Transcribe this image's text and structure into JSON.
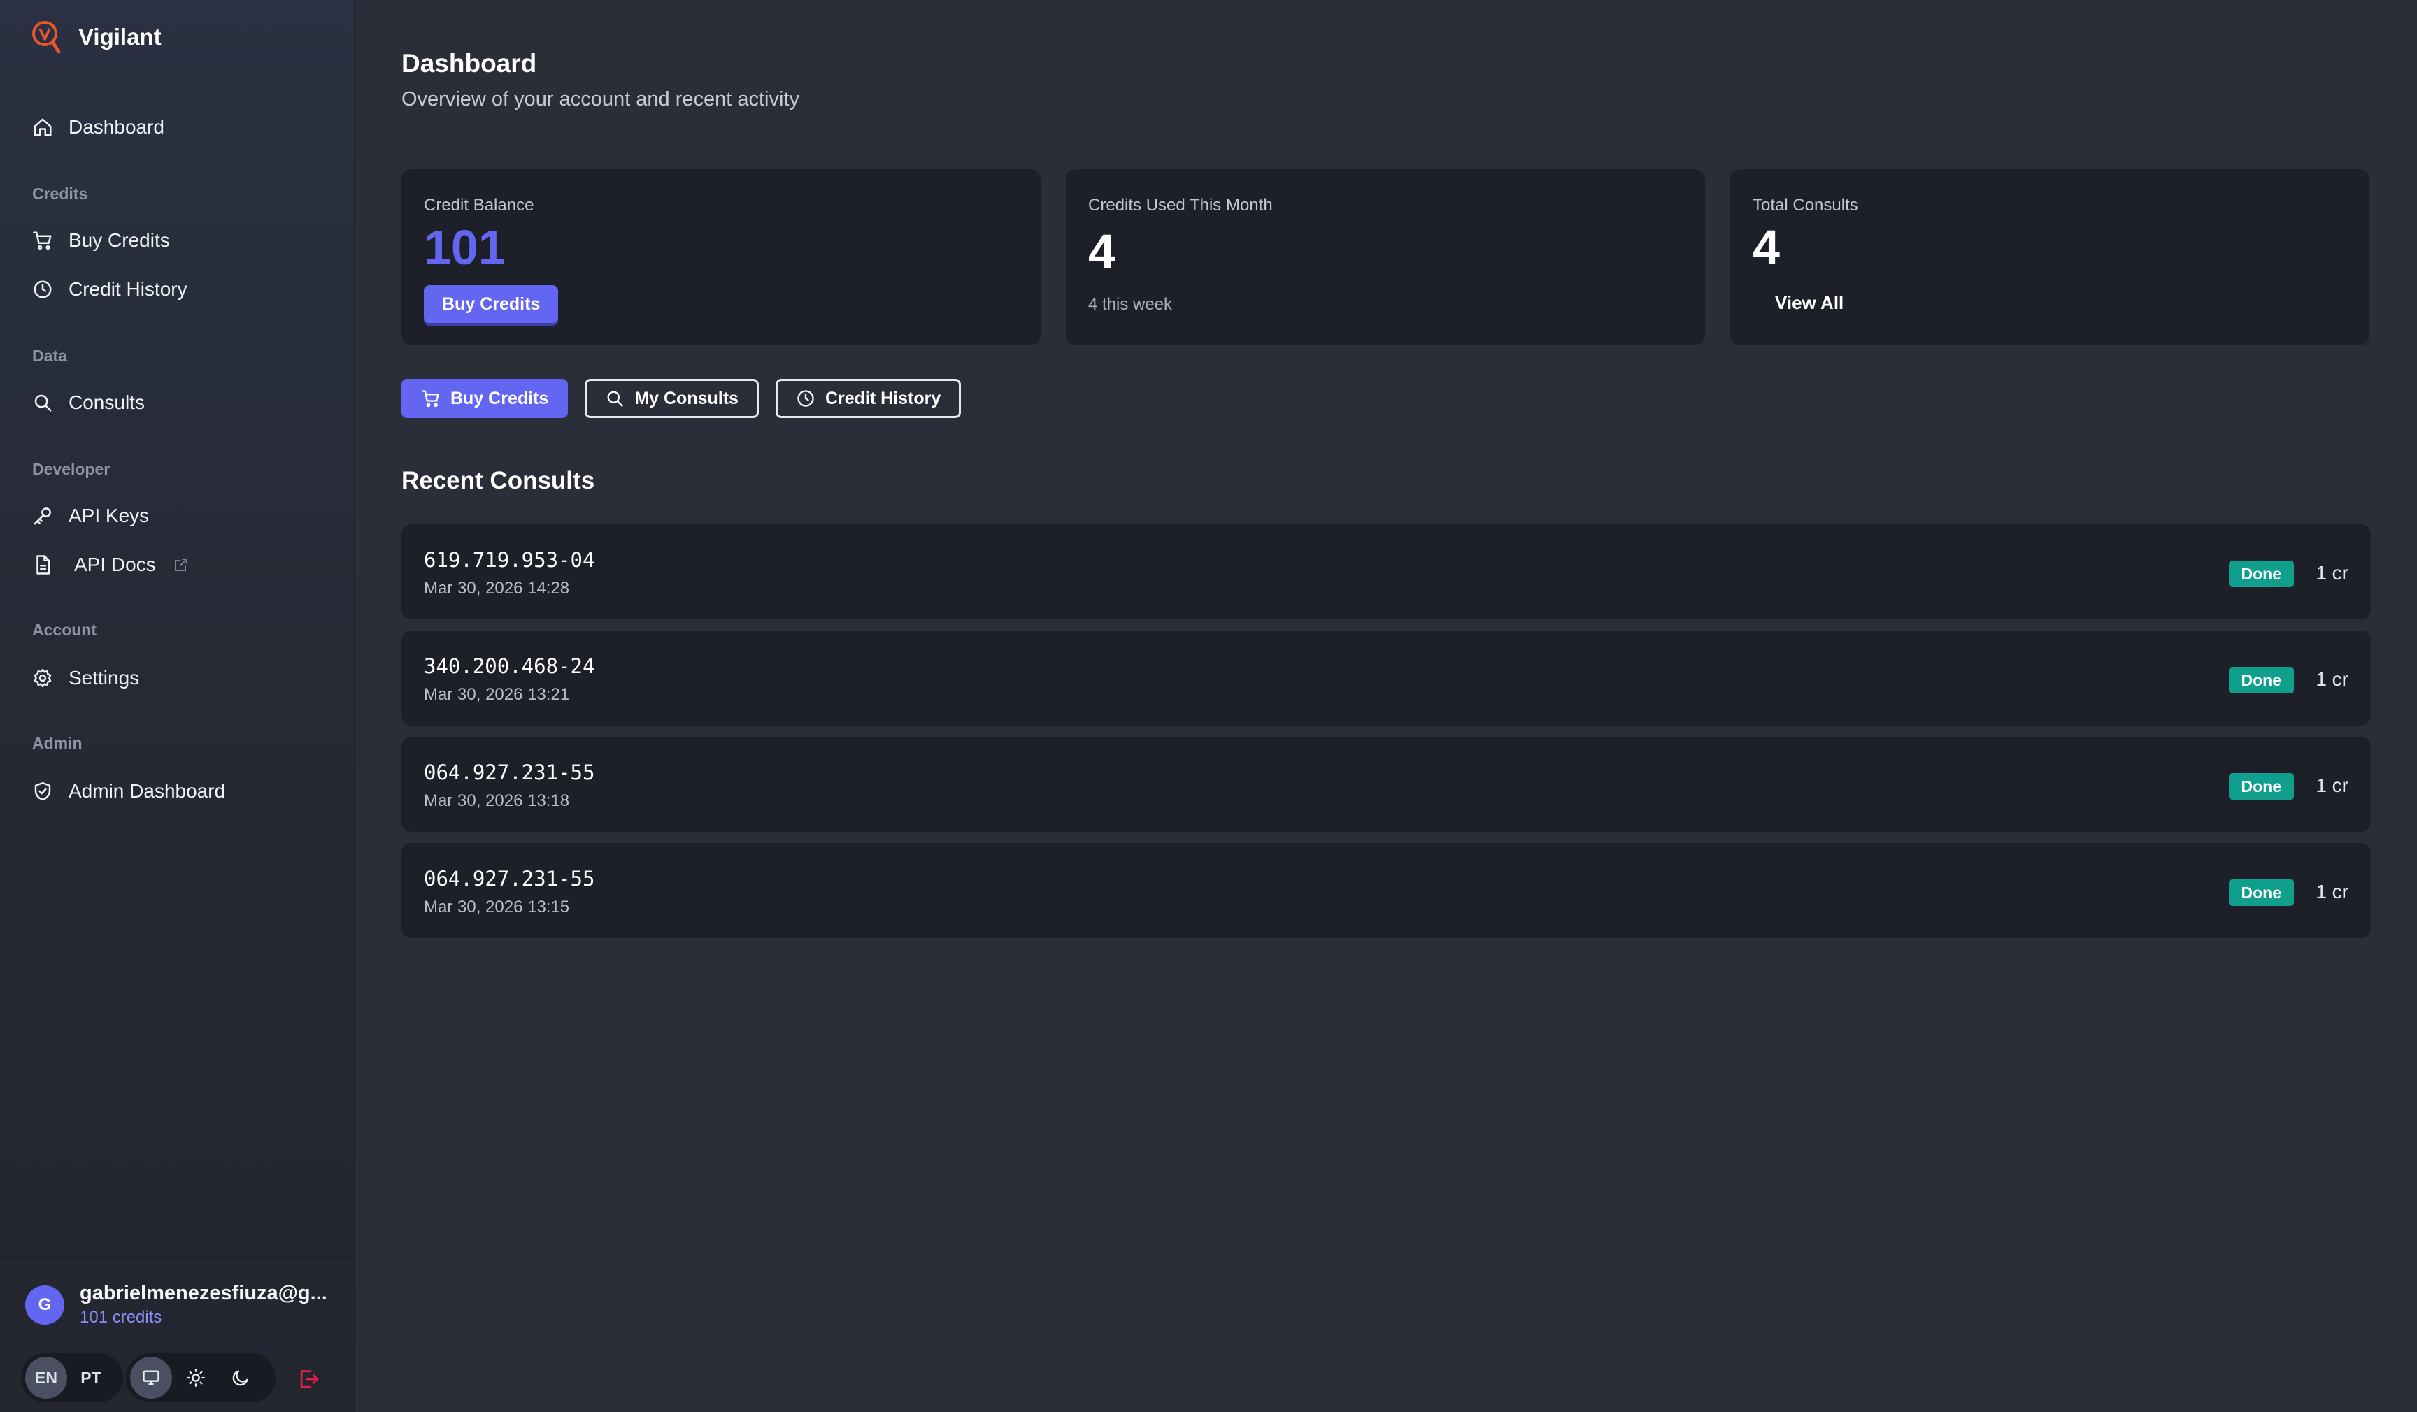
{
  "brand": {
    "name": "Vigilant",
    "accent_color": "#e8562a"
  },
  "sidebar": {
    "dashboard_label": "Dashboard",
    "sections": {
      "credits": "Credits",
      "data": "Data",
      "developer": "Developer",
      "account": "Account",
      "admin": "Admin"
    },
    "items": {
      "buy_credits": "Buy Credits",
      "credit_history": "Credit History",
      "consults": "Consults",
      "api_keys": "API Keys",
      "api_docs": "API Docs",
      "settings": "Settings",
      "admin_dashboard": "Admin Dashboard"
    }
  },
  "user": {
    "initial": "G",
    "email": "gabrielmenezesfiuza@g...",
    "credits": "101 credits"
  },
  "footer": {
    "lang_en": "EN",
    "lang_pt": "PT",
    "active_language": "EN",
    "active_theme": "system"
  },
  "page": {
    "title": "Dashboard",
    "subtitle": "Overview of your account and recent activity"
  },
  "cards": {
    "balance": {
      "label": "Credit Balance",
      "value": "101",
      "button": "Buy Credits"
    },
    "used": {
      "label": "Credits Used This Month",
      "value": "4",
      "sub": "4 this week"
    },
    "total": {
      "label": "Total Consults",
      "value": "4",
      "link": "View All"
    }
  },
  "actions": {
    "buy_credits": "Buy Credits",
    "my_consults": "My Consults",
    "credit_history": "Credit History"
  },
  "recent": {
    "title": "Recent Consults",
    "items": [
      {
        "id": "619.719.953-04",
        "date": "Mar 30, 2026 14:28",
        "status": "Done",
        "cost": "1 cr"
      },
      {
        "id": "340.200.468-24",
        "date": "Mar 30, 2026 13:21",
        "status": "Done",
        "cost": "1 cr"
      },
      {
        "id": "064.927.231-55",
        "date": "Mar 30, 2026 13:18",
        "status": "Done",
        "cost": "1 cr"
      },
      {
        "id": "064.927.231-55",
        "date": "Mar 30, 2026 13:15",
        "status": "Done",
        "cost": "1 cr"
      }
    ]
  },
  "colors": {
    "primary": "#6366f1",
    "success": "#0f9f8c",
    "danger": "#e11d48"
  }
}
